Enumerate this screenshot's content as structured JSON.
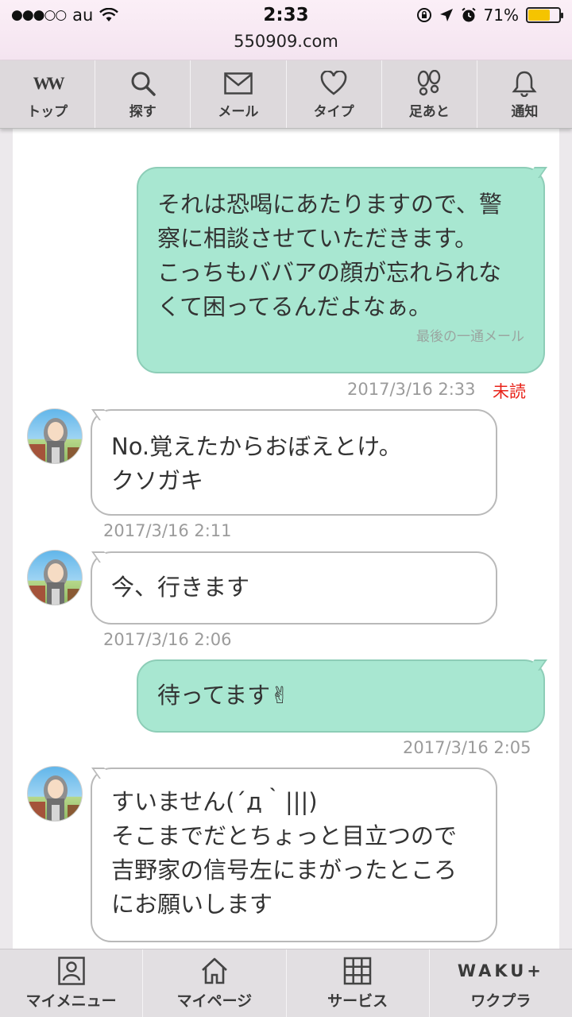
{
  "status_bar": {
    "carrier": "au",
    "signal": "●●●○○",
    "time": "2:33",
    "url": "550909.com",
    "battery_percent": "71%",
    "battery_level": 0.71,
    "battery_color": "#f5c400"
  },
  "top_nav": {
    "items": [
      {
        "label": "トップ",
        "icon": "ww-logo-icon",
        "logo": "W"
      },
      {
        "label": "探す",
        "icon": "search-icon"
      },
      {
        "label": "メール",
        "icon": "mail-icon"
      },
      {
        "label": "タイプ",
        "icon": "heart-icon"
      },
      {
        "label": "足あと",
        "icon": "footprint-icon"
      },
      {
        "label": "通知",
        "icon": "bell-icon"
      }
    ]
  },
  "messages": [
    {
      "direction": "out",
      "text": "それは恐喝にあたりますので、警\n察に相談させていただきます。\nこっちもババアの顔が忘れられな\nくて困ってるんだよなぁ。",
      "note": "最後の一通メール",
      "timestamp": "2017/3/16 2:33",
      "status": "未読"
    },
    {
      "direction": "in",
      "text": "No.覚えたからおぼえとけ。\nクソガキ",
      "timestamp": "2017/3/16 2:11"
    },
    {
      "direction": "in",
      "text": "今、行きます",
      "timestamp": "2017/3/16 2:06"
    },
    {
      "direction": "out",
      "text": "待ってます✌",
      "timestamp": "2017/3/16 2:05"
    },
    {
      "direction": "in",
      "text": "すいません(´д｀|||)\nそこまでだとちょっと目立つので\n吉野家の信号左にまがったところ\nにお願いします"
    }
  ],
  "bottom_nav": {
    "items": [
      {
        "label": "マイメニュー",
        "icon": "person-card-icon"
      },
      {
        "label": "マイページ",
        "icon": "home-icon"
      },
      {
        "label": "サービス",
        "icon": "grid-icon"
      },
      {
        "label": "ワクプラ",
        "icon": "waku-plus-logo",
        "logo": "WAKU+"
      }
    ]
  },
  "colors": {
    "outgoing_bubble": "#a8e7d1",
    "incoming_bubble": "#ffffff",
    "unread": "#e8231a",
    "nav_background": "#ddd9dc"
  }
}
